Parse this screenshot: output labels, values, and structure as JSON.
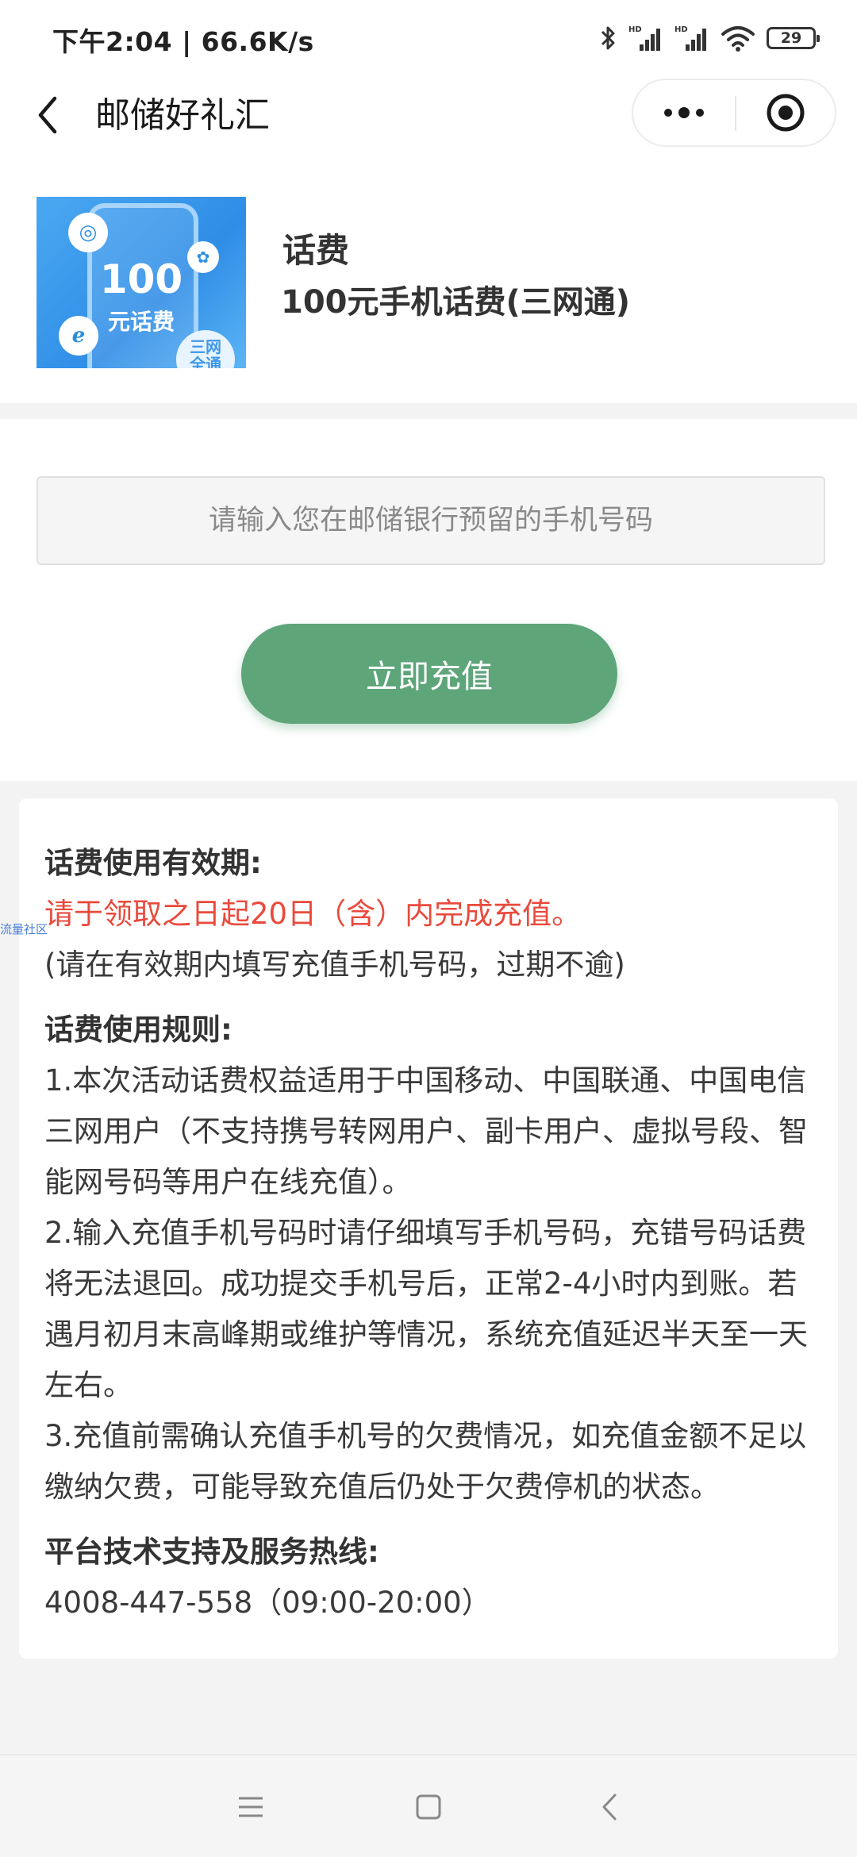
{
  "status_bar": {
    "time_speed": "下午2:04 | 66.6K/s",
    "battery": "29",
    "icons": [
      "bluetooth-icon",
      "signal-hd-icon",
      "signal-hd-icon",
      "wifi-icon",
      "battery-icon"
    ]
  },
  "nav": {
    "title": "邮储好礼汇"
  },
  "product": {
    "category": "话费",
    "name": "100元手机话费(三网通)",
    "image_amount": "100",
    "image_label": "元话费",
    "image_badge": "三网\n全通"
  },
  "form": {
    "phone_placeholder": "请输入您在邮储银行预留的手机号码",
    "submit_label": "立即充值"
  },
  "rules": {
    "validity_heading": "话费使用有效期:",
    "validity_red": "请于领取之日起20日（含）内完成充值。",
    "validity_note": "(请在有效期内填写充值手机号码，过期不逾)",
    "rules_heading": "话费使用规则:",
    "rule1": "1.本次活动话费权益适用于中国移动、中国联通、中国电信三网用户（不支持携号转网用户、副卡用户、虚拟号段、智能网号码等用户在线充值）。",
    "rule2": "2.输入充值手机号码时请仔细填写手机号码，充错号码话费将无法退回。成功提交手机号后，正常2-4小时内到账。若遇月初月末高峰期或维护等情况，系统充值延迟半天至一天左右。",
    "rule3": "3.充值前需确认充值手机号的欠费情况，如充值金额不足以缴纳欠费，可能导致充值后仍处于欠费停机的状态。",
    "hotline_heading": "平台技术支持及服务热线:",
    "hotline": "4008-447-558（09:00-20:00）"
  },
  "side_tag": "流量社区",
  "colors": {
    "accent_green": "#5ea57a",
    "warning_red": "#e94a3c"
  }
}
